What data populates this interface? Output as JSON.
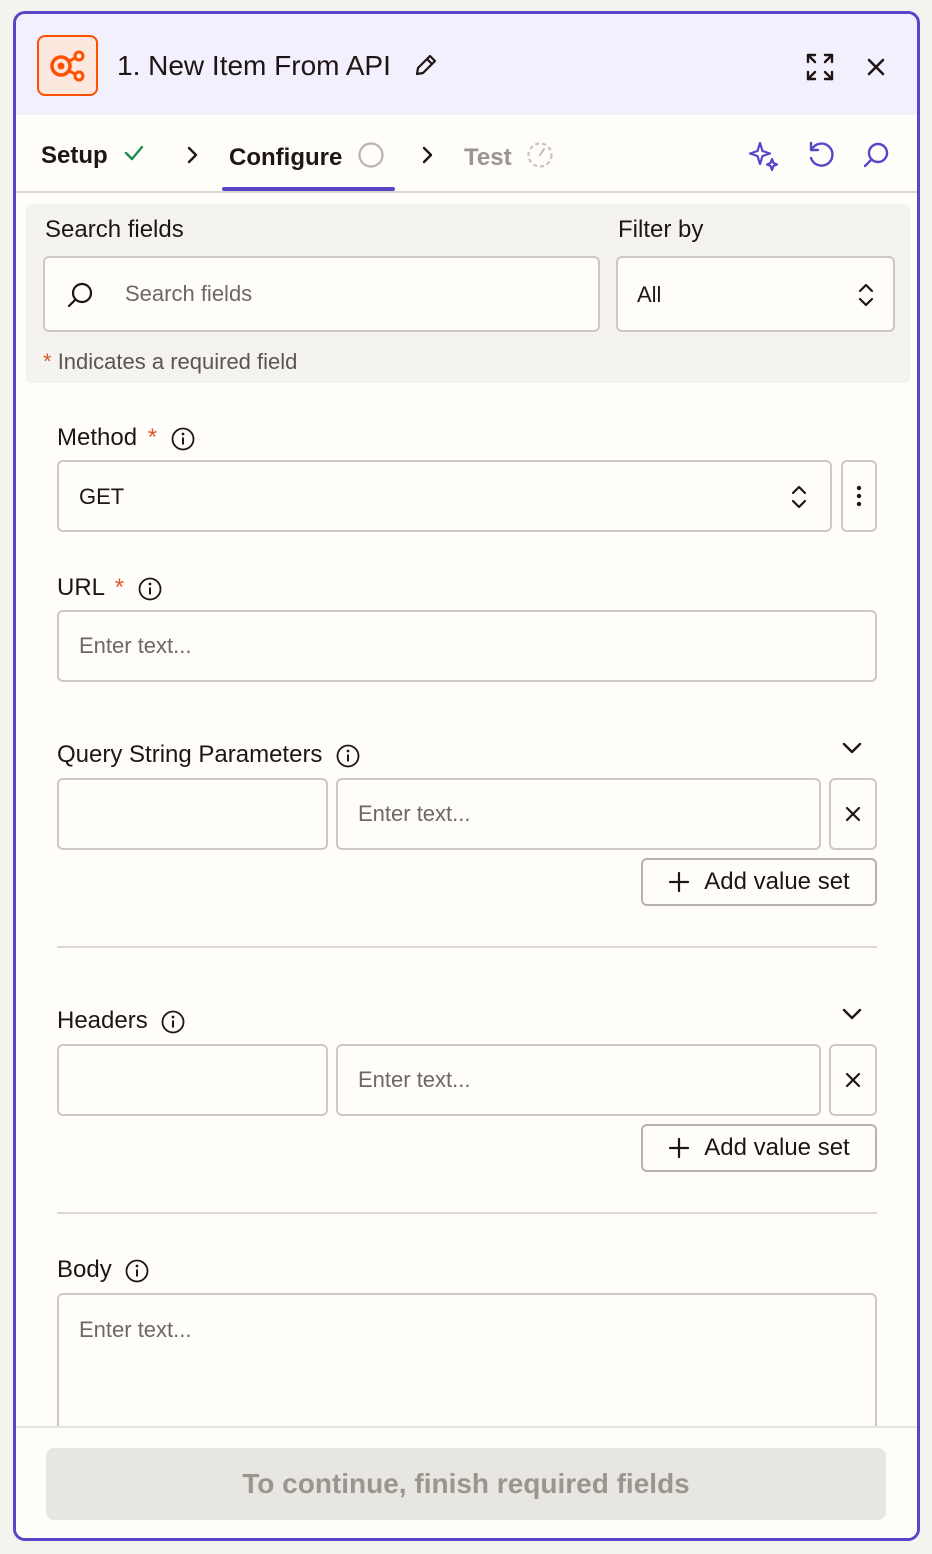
{
  "header": {
    "title": "1. New Item From API",
    "icons": [
      "webhook-app-icon",
      "pencil-icon",
      "expand-icon",
      "close-icon"
    ]
  },
  "tabs": [
    {
      "label": "Setup",
      "state": "complete"
    },
    {
      "label": "Configure",
      "state": "active"
    },
    {
      "label": "Test",
      "state": "pending"
    }
  ],
  "search": {
    "label": "Search fields",
    "placeholder": "Search fields",
    "filter_label": "Filter by",
    "filter_value": "All",
    "required_star": "*",
    "required_note": "Indicates a required field"
  },
  "fields": {
    "method": {
      "label": "Method",
      "star": "*",
      "value": "GET"
    },
    "url": {
      "label": "URL",
      "star": "*",
      "placeholder": "Enter text..."
    },
    "query": {
      "label": "Query String Parameters",
      "value_placeholder": "Enter text...",
      "add_label": "Add value set"
    },
    "headers": {
      "label": "Headers",
      "value_placeholder": "Enter text...",
      "add_label": "Add value set"
    },
    "body": {
      "label": "Body",
      "placeholder": "Enter text..."
    }
  },
  "footer": {
    "continue_label": "To continue, finish required fields"
  },
  "colors": {
    "accent": "#5646c8",
    "brand_orange": "#ff4f00",
    "success": "#1f8a4c",
    "required": "#e0562b"
  }
}
